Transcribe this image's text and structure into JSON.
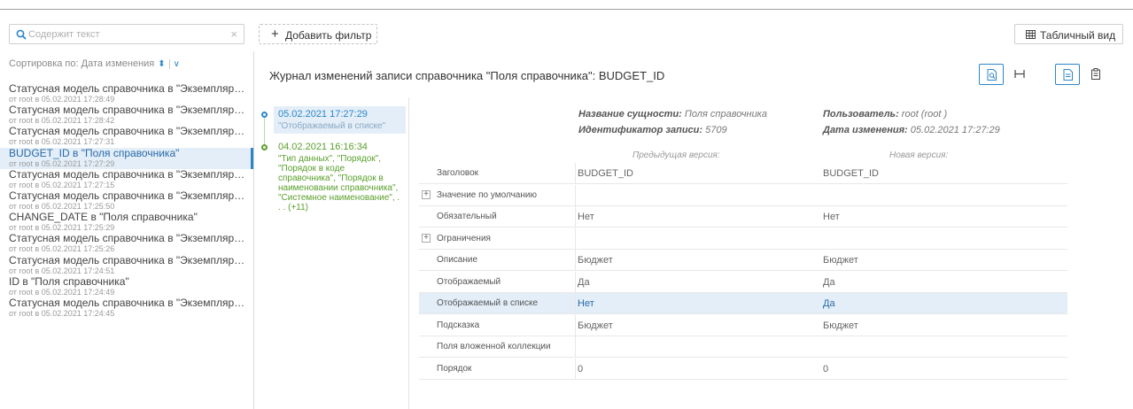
{
  "toolbar": {
    "search_placeholder": "Содержит текст",
    "clear_symbol": "×",
    "add_filter_icon": "+",
    "add_filter_label": "Добавить фильтр",
    "table_view_label": "Табличный вид"
  },
  "sort": {
    "label": "Сортировка по: Дата изменения",
    "sort_arrows": "⬍",
    "dropdown_chevron": "∨"
  },
  "list": {
    "items": [
      {
        "title": "Статусная модель справочника в \"Экземпляры справочника\"",
        "subtitle": "от root в 05.02.2021 17:28:49",
        "selected": false
      },
      {
        "title": "Статусная модель справочника в \"Экземпляры справочника\"",
        "subtitle": "от root в 05.02.2021 17:28:42",
        "selected": false
      },
      {
        "title": "Статусная модель справочника в \"Экземпляры справочника\"",
        "subtitle": "от root в 05.02.2021 17:27:31",
        "selected": false
      },
      {
        "title": "BUDGET_ID в \"Поля справочника\"",
        "subtitle": "от root в 05.02.2021 17:27:29",
        "selected": true
      },
      {
        "title": "Статусная модель справочника в \"Экземпляры справочника\"",
        "subtitle": "от root в 05.02.2021 17:27:15",
        "selected": false
      },
      {
        "title": "Статусная модель справочника в \"Экземпляры справочника\"",
        "subtitle": "от root в 05.02.2021 17:25:50",
        "selected": false
      },
      {
        "title": "CHANGE_DATE в \"Поля справочника\"",
        "subtitle": "от root в 05.02.2021 17:25:29",
        "selected": false
      },
      {
        "title": "Статусная модель справочника в \"Экземпляры справочника\"",
        "subtitle": "от root в 05.02.2021 17:25:26",
        "selected": false
      },
      {
        "title": "Статусная модель справочника в \"Экземпляры справочника\"",
        "subtitle": "от root в 05.02.2021 17:24:51",
        "selected": false
      },
      {
        "title": "ID в \"Поля справочника\"",
        "subtitle": "от root в 05.02.2021 17:24:49",
        "selected": false
      },
      {
        "title": "Статусная модель справочника в \"Экземпляры справочника\"",
        "subtitle": "от root в 05.02.2021 17:24:45",
        "selected": false
      }
    ]
  },
  "header": {
    "title": "Журнал изменений записи справочника \"Поля справочника\": BUDGET_ID"
  },
  "timeline": {
    "entries": [
      {
        "date": "05.02.2021 17:27:29",
        "description": "\"Отображаемый в списке\"",
        "selected": true,
        "color": "#2e86c8"
      },
      {
        "date": "04.02.2021 16:16:34",
        "description": "\"Тип данных\", \"Порядок\", \"Порядок в коде справочника\", \"Порядок в наименовании справочника\", \"Системное наименование\", . . . (+11)",
        "selected": false,
        "color": "#5aa02c"
      }
    ]
  },
  "details": {
    "entity_label": "Название сущности:",
    "entity_value": "Поля справочника",
    "record_id_label": "Идентификатор записи:",
    "record_id_value": "5709",
    "user_label": "Пользователь:",
    "user_value": "root (root )",
    "changed_label": "Дата изменения:",
    "changed_value": "05.02.2021 17:27:29",
    "prev_header": "Предыдущая версия:",
    "next_header": "Новая версия:",
    "rows": [
      {
        "name": "Заголовок",
        "prev": "BUDGET_ID",
        "next": "BUDGET_ID",
        "expandable": false,
        "highlight": false
      },
      {
        "name": "Значение по умолчанию",
        "prev": "",
        "next": "",
        "expandable": true,
        "highlight": false
      },
      {
        "name": "Обязательный",
        "prev": "Нет",
        "next": "Нет",
        "expandable": false,
        "highlight": false
      },
      {
        "name": "Ограничения",
        "prev": "",
        "next": "",
        "expandable": true,
        "highlight": false
      },
      {
        "name": "Описание",
        "prev": "Бюджет",
        "next": "Бюджет",
        "expandable": false,
        "highlight": false
      },
      {
        "name": "Отображаемый",
        "prev": "Да",
        "next": "Да",
        "expandable": false,
        "highlight": false
      },
      {
        "name": "Отображаемый в списке",
        "prev": "Нет",
        "next": "Да",
        "expandable": false,
        "highlight": true
      },
      {
        "name": "Подсказка",
        "prev": "Бюджет",
        "next": "Бюджет",
        "expandable": false,
        "highlight": false
      },
      {
        "name": "Поля вложенной коллекции",
        "prev": "",
        "next": "",
        "expandable": false,
        "highlight": false
      },
      {
        "name": "Порядок",
        "prev": "0",
        "next": "0",
        "expandable": false,
        "highlight": false
      }
    ],
    "expand_symbol": "+"
  },
  "colors": {
    "accent": "#2e86c8",
    "selected_bg": "#e3eef8",
    "timeline_green": "#5aa02c"
  }
}
